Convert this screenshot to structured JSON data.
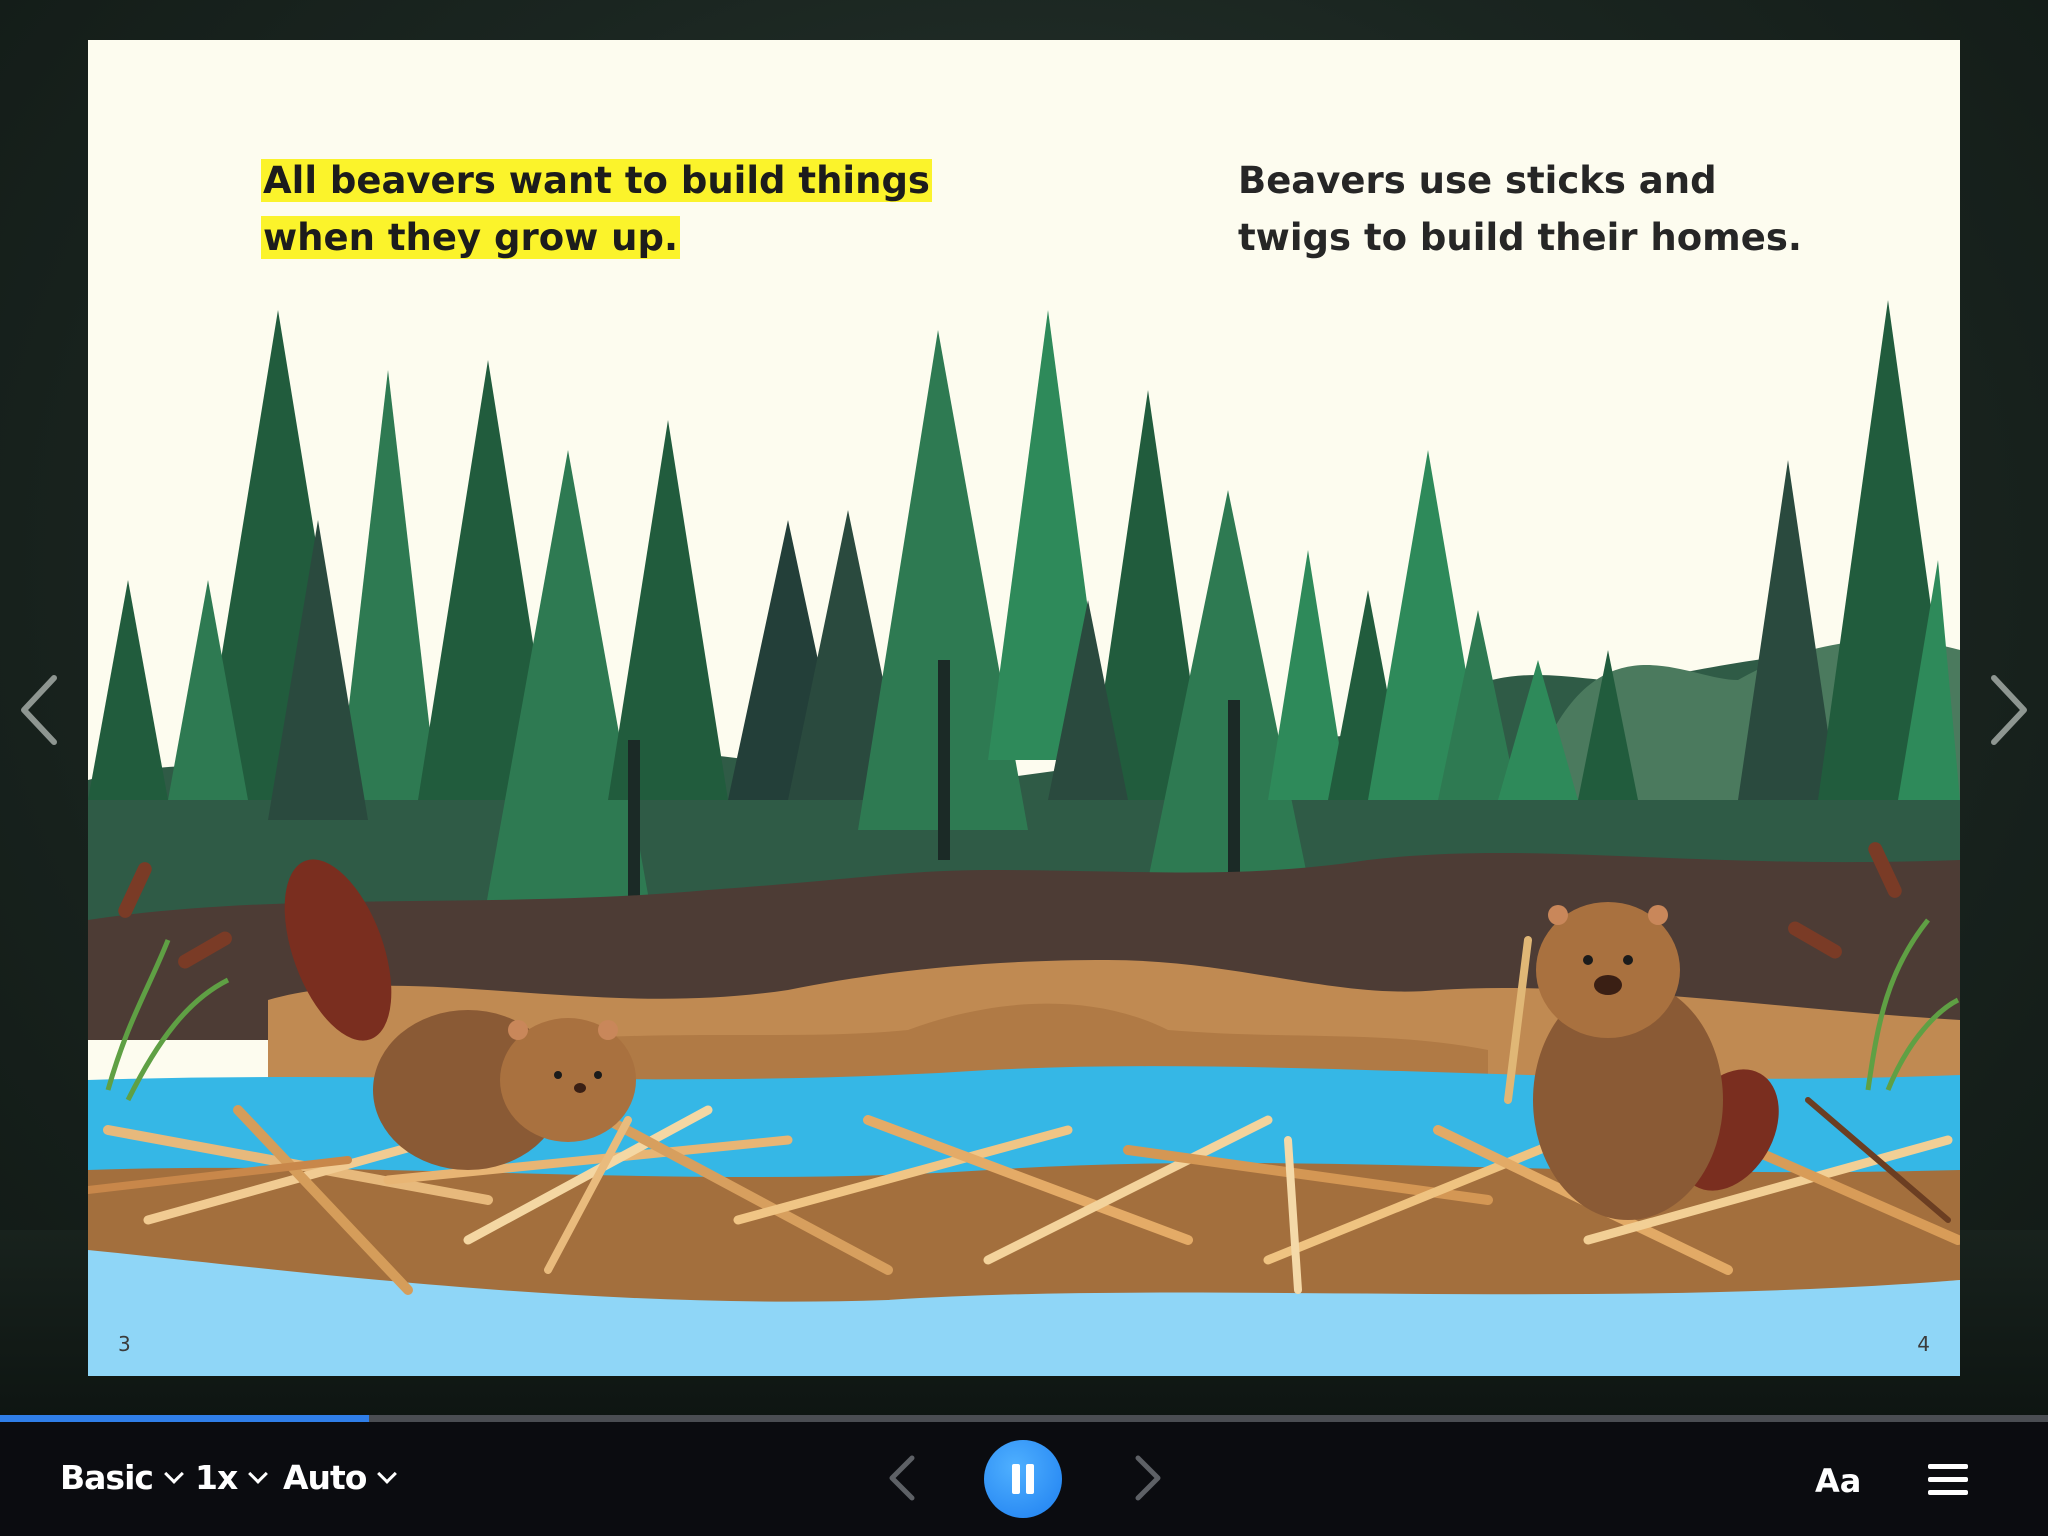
{
  "book": {
    "left_page_text": "All beavers want to build things when they grow up.",
    "right_page_text": "Beavers use sticks and twigs to build their homes.",
    "left_page_number": "3",
    "right_page_number": "4",
    "highlight_color": "#fbf32b"
  },
  "reader": {
    "progress_fraction": 0.18
  },
  "toolbar": {
    "level_label": "Basic",
    "speed_label": "1x",
    "mode_label": "Auto",
    "text_settings_label": "Aa",
    "play_state": "playing",
    "accent_color": "#2f7ee8"
  },
  "icons": {
    "prev": "chevron-left-icon",
    "next": "chevron-right-icon",
    "pause": "pause-icon",
    "menu": "hamburger-menu-icon"
  }
}
